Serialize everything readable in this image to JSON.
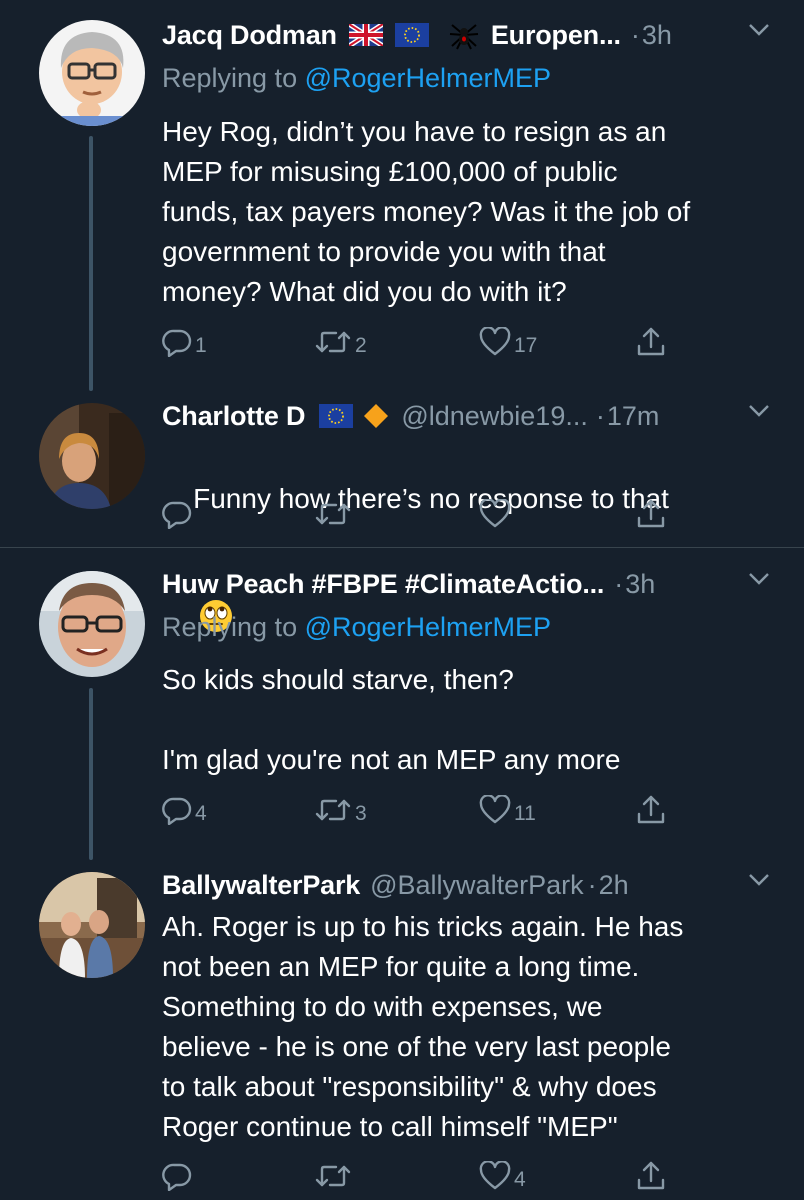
{
  "colors": {
    "background": "#16202c",
    "text": "#ffffff",
    "muted": "#8899a6",
    "link": "#1da1f2",
    "thread_line": "#3d5466",
    "divider": "#38444d"
  },
  "tweets": [
    {
      "name": "Jacq Dodman",
      "badges": [
        "uk-flag-icon",
        "eu-flag-icon",
        "spider-icon"
      ],
      "name_suffix": "Europen...",
      "handle": "",
      "time": "3h",
      "replying_prefix": "Replying to ",
      "replying_to": "@RogerHelmerMEP",
      "text": "Hey Rog, didn’t you have to resign as an\nMEP for misusing £100,000 of public\nfunds, tax payers money? Was it the job of\ngovernment to provide you with that\nmoney? What did you do with it?",
      "replies": "1",
      "retweets": "2",
      "likes": "17"
    },
    {
      "name": "Charlotte D",
      "badges": [
        "eu-flag-icon",
        "orange-diamond-icon"
      ],
      "handle": "@ldnewbie19...",
      "time": "17m",
      "text": "Funny how there’s no response to that",
      "text_emoji": "eye-roll-emoji-icon",
      "replies": "",
      "retweets": "",
      "likes": ""
    },
    {
      "name": "Huw Peach #FBPE #ClimateActio...",
      "handle": "",
      "time": "3h",
      "replying_prefix": "Replying to ",
      "replying_to": "@RogerHelmerMEP",
      "text": "So kids should starve, then?\n\nI'm glad you're not an MEP any more",
      "replies": "4",
      "retweets": "3",
      "likes": "11"
    },
    {
      "name": "BallywalterPark",
      "handle": "@BallywalterPark",
      "time": "2h",
      "text": "Ah. Roger is up to his tricks again. He has\nnot been an MEP for quite a long time.\nSomething to do with expenses, we\nbelieve - he is one of the very last people\nto talk about \"responsibility\" & why does\nRoger continue to call himself \"MEP\"",
      "replies": "",
      "retweets": "",
      "likes": "4"
    }
  ],
  "separator": "·"
}
